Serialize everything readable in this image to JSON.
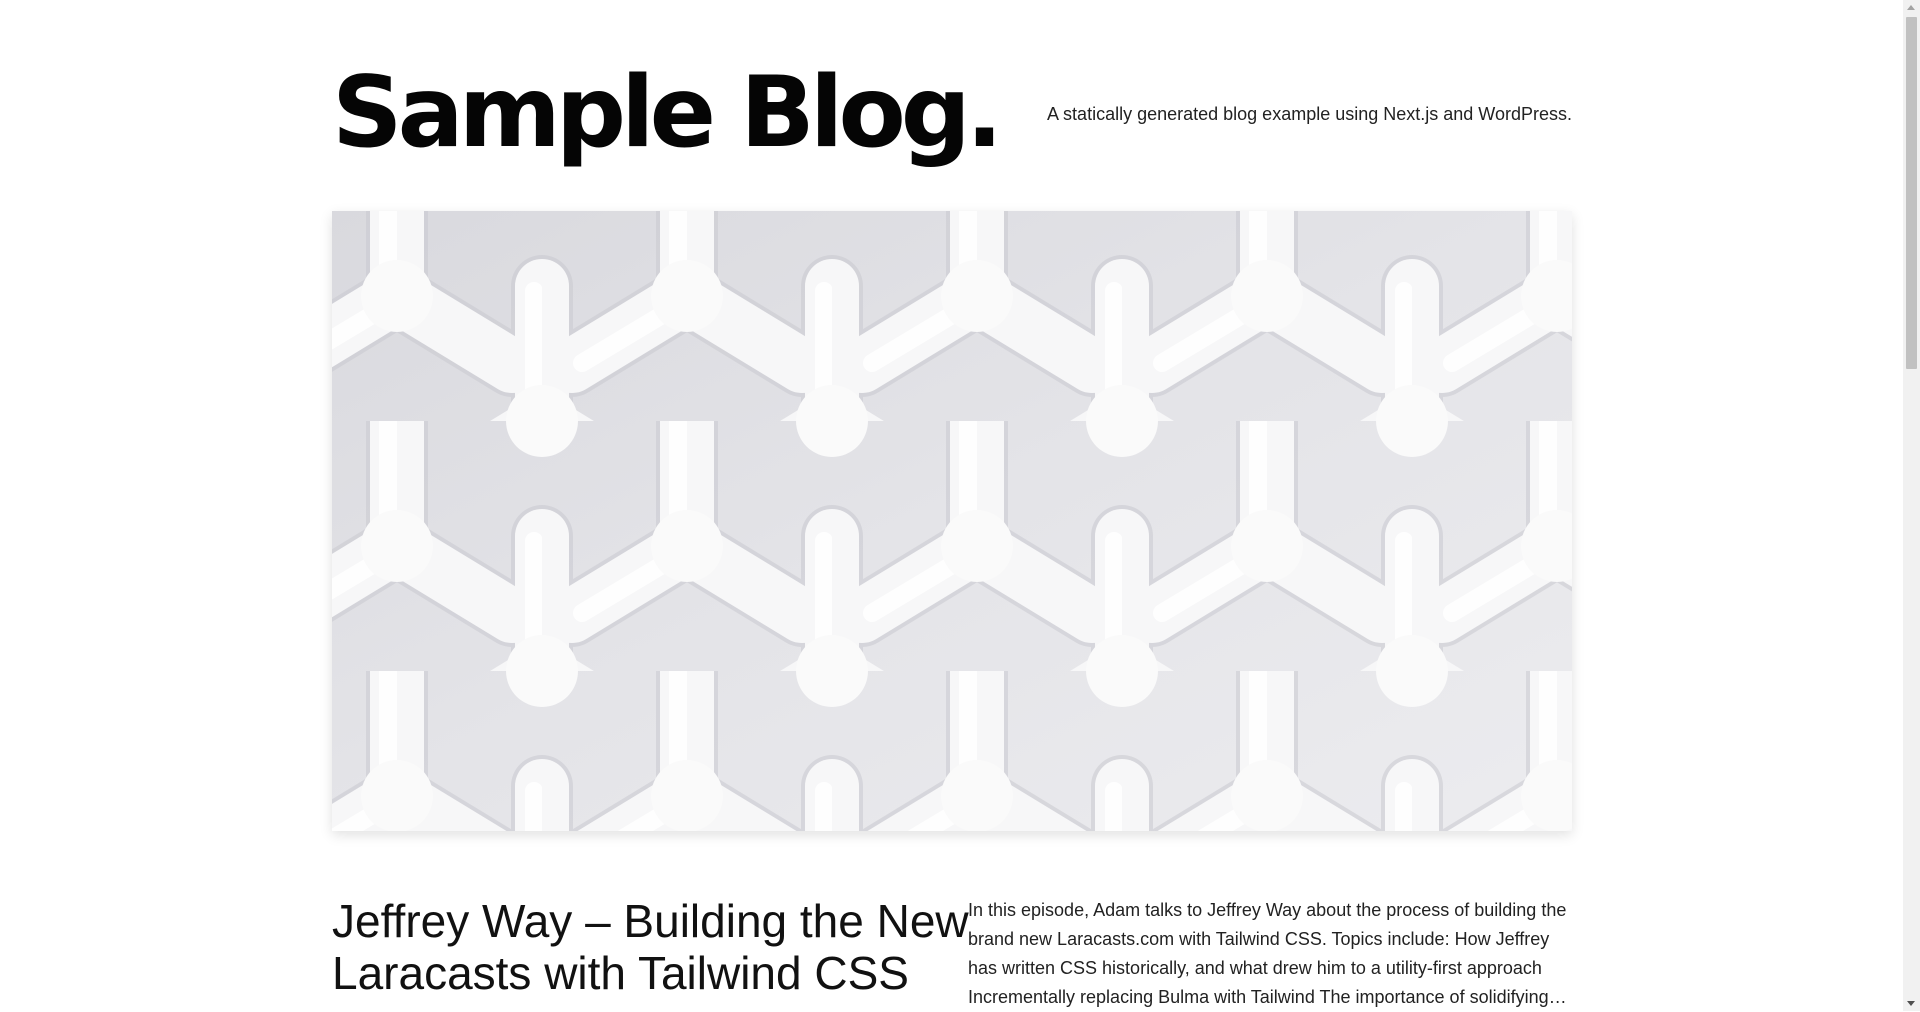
{
  "header": {
    "blog_title": "Sample Blog.",
    "tagline": "A statically generated blog example using Next.js and WordPress."
  },
  "hero": {
    "image_alt": "White geometric woven lattice architecture",
    "base_color": "#e6e6e9",
    "lattice_color": "#fafafa"
  },
  "featured_post": {
    "title": "Jeffrey Way – Building the New Laracasts with Tailwind CSS",
    "excerpt": "In this episode, Adam talks to Jeffrey Way about the process of building the brand new Laracasts.com with Tailwind CSS. Topics include: How Jeffrey has written CSS historically, and what drew him to a utility-first approach Incrementally replacing Bulma with Tailwind The importance of solidifying…"
  },
  "colors": {
    "background": "#ffffff",
    "title_text": "#050505",
    "body_text": "#222222",
    "scrollbar_track": "#f1f1f1",
    "scrollbar_thumb": "#c1c1c1"
  }
}
